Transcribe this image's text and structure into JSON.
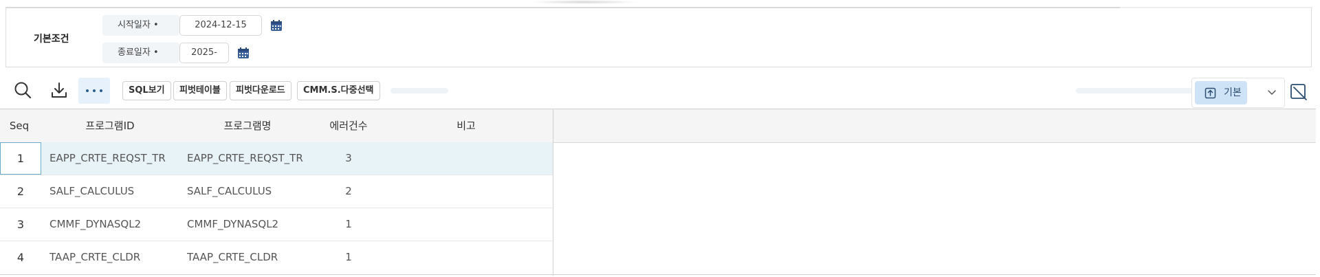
{
  "search_panel": {
    "title": "기본조건",
    "start_date": {
      "label": "시작일자 •",
      "value": "2024-12-15"
    },
    "end_date": {
      "label": "종료일자 •",
      "value": "2025-"
    }
  },
  "toolbar": {
    "icons": [
      "search-icon",
      "download-icon",
      "more-icon"
    ],
    "buttons": [
      "SQL보기",
      "피벗테이블",
      "피벗다운로드",
      "CMM.S.다중선택"
    ],
    "view_selector": {
      "label": "기본",
      "icon": "export-icon"
    }
  },
  "grid": {
    "columns": [
      "Seq",
      "프로그램ID",
      "프로그램명",
      "에러건수",
      "비고"
    ],
    "rows": [
      {
        "seq": "1",
        "program_id": "EAPP_CRTE_REQST_TR",
        "program_name": "EAPP_CRTE_REQST_TR",
        "error_count": "3",
        "note": ""
      },
      {
        "seq": "2",
        "program_id": "SALF_CALCULUS",
        "program_name": "SALF_CALCULUS",
        "error_count": "2",
        "note": ""
      },
      {
        "seq": "3",
        "program_id": "CMMF_DYNASQL2",
        "program_name": "CMMF_DYNASQL2",
        "error_count": "1",
        "note": ""
      },
      {
        "seq": "4",
        "program_id": "TAAP_CRTE_CLDR",
        "program_name": "TAAP_CRTE_CLDR",
        "error_count": "1",
        "note": ""
      }
    ],
    "selected_row": 1
  },
  "colors": {
    "selected_row_bg": "#e8f3f8",
    "accent": "#2a5d8f",
    "header_bg": "#f5f5f5"
  }
}
